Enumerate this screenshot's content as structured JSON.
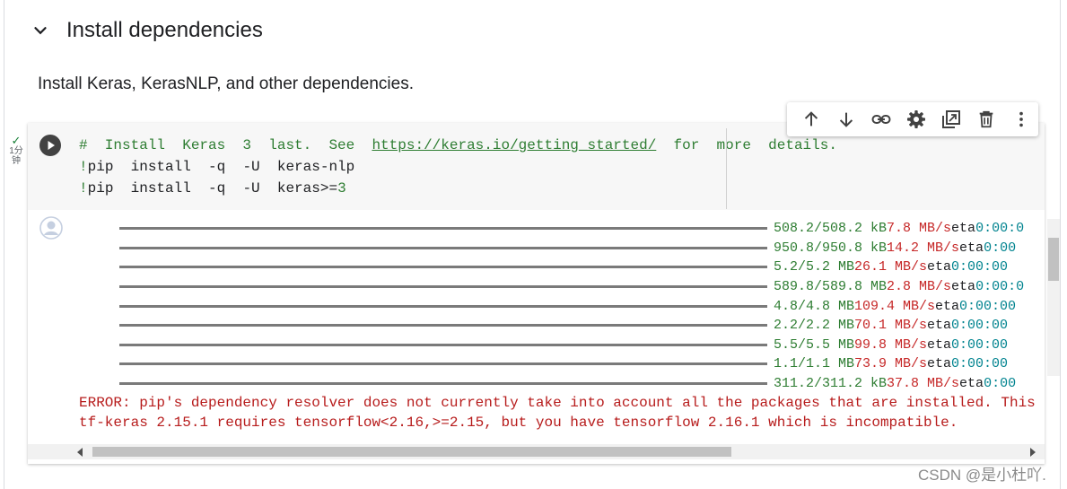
{
  "section": {
    "title": "Install dependencies",
    "description": "Install Keras, KerasNLP, and other dependencies."
  },
  "exec_status": {
    "line1": "1分",
    "line2": "钟"
  },
  "toolbar_icons": [
    "arrow-up-icon",
    "arrow-down-icon",
    "link-icon",
    "gear-icon",
    "mirror-cell-icon",
    "trash-icon",
    "more-vert-icon"
  ],
  "code": {
    "comment_pre": "#  Install  Keras  3  last.  See  ",
    "link": "https://keras.io/getting_started/",
    "comment_post": "  for  more  details.",
    "line2_bang": "!",
    "line2": "pip  install  -q  -U  keras-nlp",
    "line3_bang": "!",
    "line3": "pip  install  -q  -U  keras>=",
    "line3_num": "3"
  },
  "progress_rows": [
    {
      "size": "508.2/508.2 kB",
      "rate": "7.8 MB/s",
      "eta": "eta",
      "time": "0:00:0"
    },
    {
      "size": "950.8/950.8 kB",
      "rate": "14.2 MB/s",
      "eta": "eta",
      "time": "0:00"
    },
    {
      "size": "5.2/5.2 MB",
      "rate": "26.1 MB/s",
      "eta": "eta",
      "time": "0:00:00"
    },
    {
      "size": "589.8/589.8 MB",
      "rate": "2.8 MB/s",
      "eta": "eta",
      "time": "0:00:0"
    },
    {
      "size": "4.8/4.8 MB",
      "rate": "109.4 MB/s",
      "eta": "eta",
      "time": "0:00:00"
    },
    {
      "size": "2.2/2.2 MB",
      "rate": "70.1 MB/s",
      "eta": "eta",
      "time": "0:00:00"
    },
    {
      "size": "5.5/5.5 MB",
      "rate": "99.8 MB/s",
      "eta": "eta",
      "time": "0:00:00"
    },
    {
      "size": "1.1/1.1 MB",
      "rate": "73.9 MB/s",
      "eta": "eta",
      "time": "0:00:00"
    },
    {
      "size": "311.2/311.2 kB",
      "rate": "37.8 MB/s",
      "eta": "eta",
      "time": "0:00"
    }
  ],
  "errors": {
    "line1": "ERROR: pip's dependency resolver does not currently take into account all the packages that are installed. This behavio",
    "line2": "tf-keras 2.15.1 requires tensorflow<2.16,>=2.15, but you have tensorflow 2.16.1 which is incompatible."
  },
  "watermark": "CSDN @是小杜吖."
}
